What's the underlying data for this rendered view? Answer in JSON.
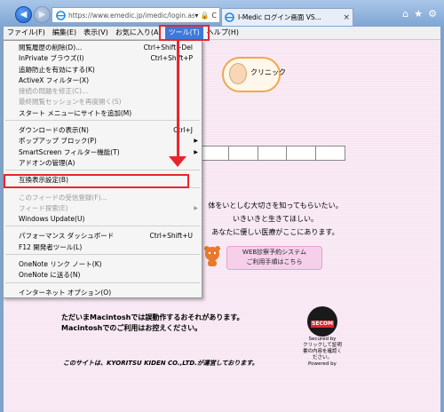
{
  "browser": {
    "address_url": "https://www.emedic.jp/imedic/login.asp",
    "address_tools": "▾ 🔒 C",
    "tab_title": "I-Medic ログイン画面 VS...",
    "tab_close": "×",
    "right_icons": [
      "home-icon",
      "star-icon",
      "gear-icon"
    ]
  },
  "menubar": {
    "items": [
      "ファイル(F)",
      "編集(E)",
      "表示(V)",
      "お気に入り(A)",
      "ツール(T)",
      "ヘルプ(H)"
    ]
  },
  "tools_menu": {
    "items": [
      {
        "label": "閲覧履歴の削除(D)...",
        "shortcut": "Ctrl+Shift+Del",
        "disabled": false
      },
      {
        "label": "InPrivate ブラウズ(I)",
        "shortcut": "Ctrl+Shift+P",
        "disabled": false
      },
      {
        "label": "追跡防止を有効にする(K)",
        "shortcut": "",
        "disabled": false
      },
      {
        "label": "ActiveX フィルター(X)",
        "shortcut": "",
        "disabled": false
      },
      {
        "label": "接続の問題を修正(C)...",
        "shortcut": "",
        "disabled": true
      },
      {
        "label": "最終閲覧セッションを再度開く(S)",
        "shortcut": "",
        "disabled": true
      },
      {
        "label": "スタート メニューにサイトを追加(M)",
        "shortcut": "",
        "disabled": false
      },
      {
        "sep": true
      },
      {
        "label": "ダウンロードの表示(N)",
        "shortcut": "Ctrl+J",
        "disabled": false
      },
      {
        "label": "ポップアップ ブロック(P)",
        "shortcut": "",
        "disabled": false,
        "submenu": true
      },
      {
        "label": "SmartScreen フィルター機能(T)",
        "shortcut": "",
        "disabled": false,
        "submenu": true
      },
      {
        "label": "アドオンの管理(A)",
        "shortcut": "",
        "disabled": false
      },
      {
        "sep": true
      },
      {
        "label": "互換表示設定(B)",
        "shortcut": "",
        "disabled": false
      },
      {
        "sep": true
      },
      {
        "label": "このフィードの受信登録(F)...",
        "shortcut": "",
        "disabled": true
      },
      {
        "label": "フィード探索(E)",
        "shortcut": "",
        "disabled": true,
        "submenu": true
      },
      {
        "label": "Windows Update(U)",
        "shortcut": "",
        "disabled": false
      },
      {
        "sep": true
      },
      {
        "label": "パフォーマンス ダッシュボード",
        "shortcut": "Ctrl+Shift+U",
        "disabled": false
      },
      {
        "label": "F12 開発者ツール(L)",
        "shortcut": "",
        "disabled": false
      },
      {
        "sep": true
      },
      {
        "label": "OneNote リンク ノート(K)",
        "shortcut": "",
        "disabled": false
      },
      {
        "label": "OneNote に送る(N)",
        "shortcut": "",
        "disabled": false
      },
      {
        "sep": true
      },
      {
        "label": "インターネット オプション(O)",
        "shortcut": "",
        "disabled": false
      }
    ]
  },
  "page": {
    "logo_text": "クリニック",
    "center_lines": [
      "体をいとしむ大切さを知ってもらいたい。",
      "いきいきと生きてほしい。",
      "あなたに優しい医療がここにあります。"
    ],
    "web_button_line1": "WEB診察予約システム",
    "web_button_line2": "ご利用手順はこちら",
    "mac_line1": "ただいまMacintoshでは誤動作するおそれがあります。",
    "mac_line2": "Macintoshでのご利用はお控えください。",
    "copyright": "このサイトは、KYORITSU KIDEN CO.,LTD.が運営しております。",
    "secom_badge_top": "Secured by",
    "secom_badge_main": "SECOM",
    "secom_text": "クリックして証明書の内容を確認ください。",
    "secom_powered": "Powered by"
  }
}
